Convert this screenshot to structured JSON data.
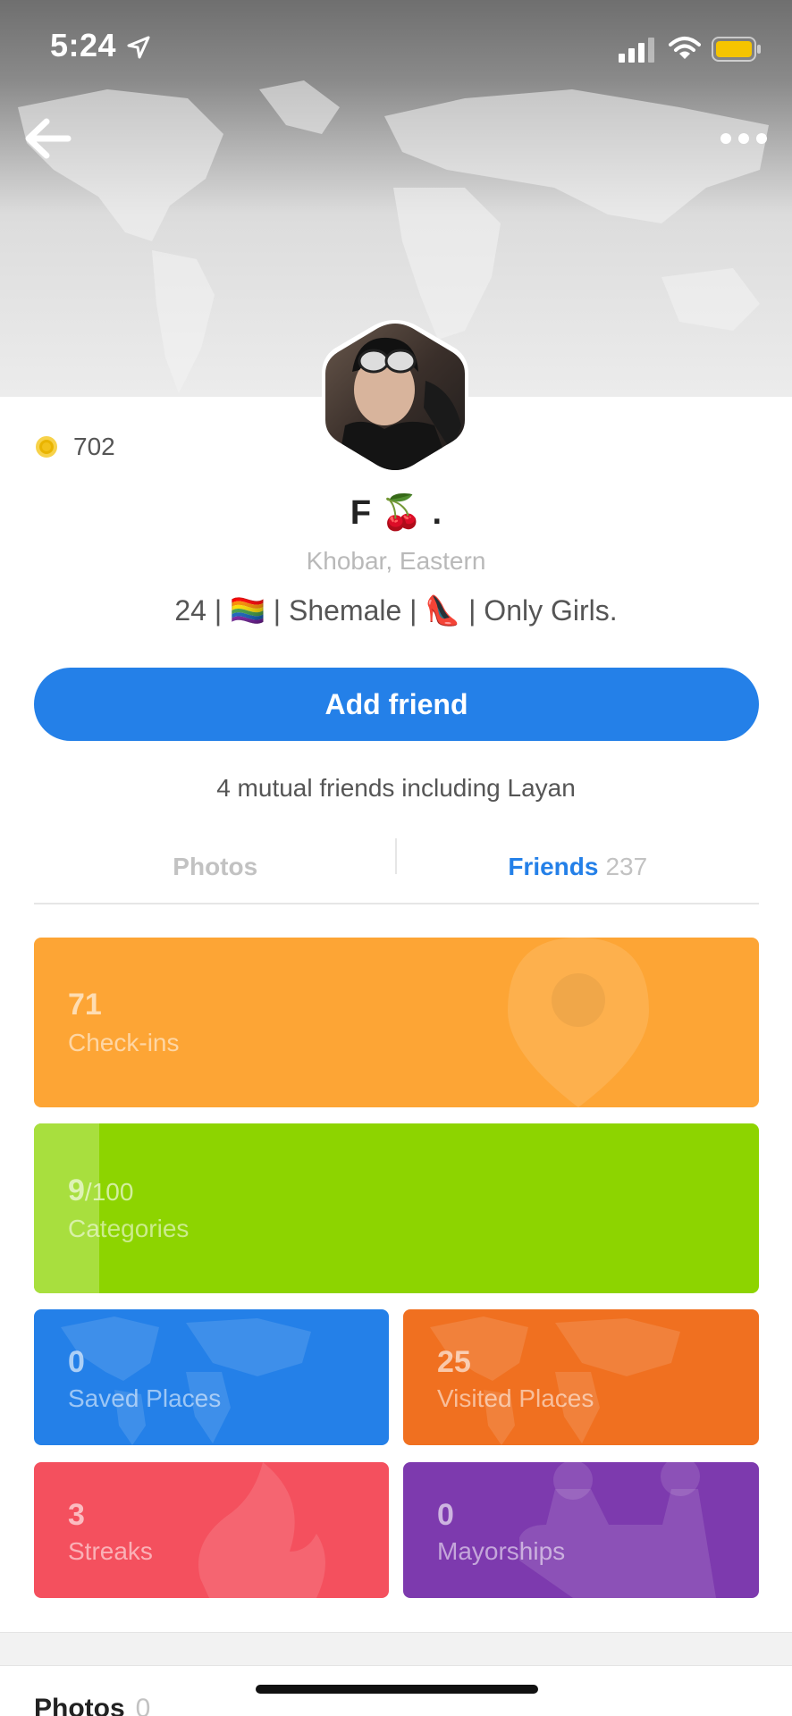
{
  "status_bar": {
    "time": "5:24",
    "icons": [
      "location-arrow-icon",
      "cellular-signal-icon",
      "wifi-icon",
      "battery-icon"
    ],
    "battery_color": "#f5c400"
  },
  "header": {
    "back_icon": "arrow-left-icon",
    "more_icon": "more-horizontal-icon"
  },
  "profile": {
    "coins": "702",
    "name": "F 🍒 .",
    "location": "Khobar, Eastern",
    "bio": "24 | 🏳️‍🌈 | Shemale | 👠 | Only Girls."
  },
  "actions": {
    "add_friend_label": "Add friend",
    "mutual_friends": "4 mutual friends including Layan"
  },
  "tabs": {
    "photos_label": "Photos",
    "friends_label": "Friends",
    "friends_count": "237"
  },
  "stats": {
    "checkins": {
      "value": "71",
      "label": "Check-ins",
      "color": "#fda535",
      "icon": "map-pin-icon"
    },
    "categories": {
      "value": "9",
      "total": "/100",
      "label": "Categories",
      "color": "#8dd400",
      "progress": 0.09
    },
    "saved": {
      "value": "0",
      "label": "Saved Places",
      "color": "#2480e8",
      "icon": "world-map-icon"
    },
    "visited": {
      "value": "25",
      "label": "Visited Places",
      "color": "#f07020",
      "icon": "world-map-icon"
    },
    "streaks": {
      "value": "3",
      "label": "Streaks",
      "color": "#f4505e",
      "icon": "flame-icon"
    },
    "mayorships": {
      "value": "0",
      "label": "Mayorships",
      "color": "#7d3aae",
      "icon": "crown-icon"
    }
  },
  "photos_section": {
    "heading": "Photos",
    "count": "0"
  },
  "colors": {
    "accent": "#2480e8"
  }
}
